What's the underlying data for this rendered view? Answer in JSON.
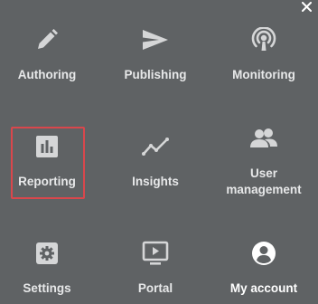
{
  "close_icon": "close-icon",
  "tiles": [
    {
      "label": "Authoring",
      "icon": "pencil-icon"
    },
    {
      "label": "Publishing",
      "icon": "send-icon"
    },
    {
      "label": "Monitoring",
      "icon": "broadcast-icon"
    },
    {
      "label": "Reporting",
      "icon": "bar-chart-icon",
      "selected": true
    },
    {
      "label": "Insights",
      "icon": "trend-line-icon"
    },
    {
      "label": "User\nmanagement",
      "icon": "users-icon"
    },
    {
      "label": "Settings",
      "icon": "gear-icon"
    },
    {
      "label": "Portal",
      "icon": "play-screen-icon"
    },
    {
      "label": "My account",
      "icon": "account-icon",
      "emphasized": true
    }
  ],
  "colors": {
    "background": "#5f6264",
    "icon": "#d5d6d7",
    "label": "#e7e8e9",
    "selection": "#d9474c"
  }
}
